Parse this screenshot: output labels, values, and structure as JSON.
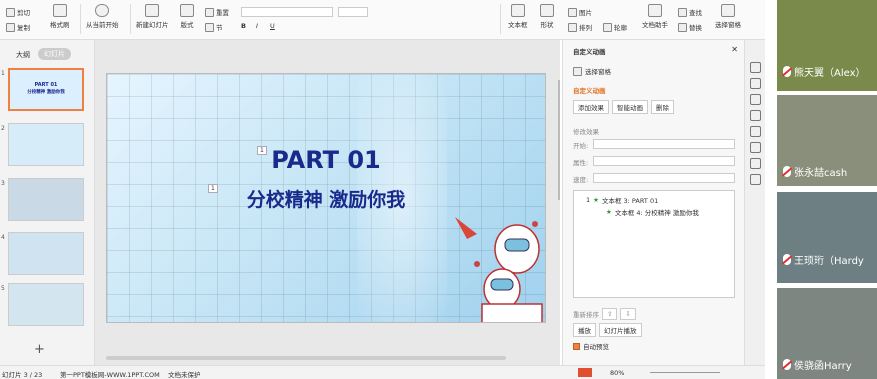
{
  "ribbon": {
    "cut": "剪切",
    "copy": "复制",
    "format_painter": "格式刷",
    "play_from_start": "从当前开始",
    "new_slide": "新建幻灯片",
    "layout": "版式",
    "reset": "重置",
    "section": "节",
    "textbox": "文本框",
    "shapes": "形状",
    "picture": "图片",
    "arrange": "排列",
    "outline": "轮廓",
    "art_text": "文档助手",
    "find": "查找",
    "replace": "替换",
    "select_pane": "选择窗格"
  },
  "left_panel": {
    "tab_outline": "大纲",
    "tab_slides": "幻灯片",
    "add_slide": "+",
    "slide_numbers": [
      "1",
      "2",
      "3",
      "4",
      "5"
    ]
  },
  "slide": {
    "title": "PART  01",
    "subtitle": "分校精神  激励你我",
    "marker1": "1",
    "marker2": "1"
  },
  "animation_pane": {
    "header": "自定义动画",
    "select_pane": "选择窗格",
    "section": "自定义动画",
    "add_effect": "添加效果",
    "smart_animation": "智能动画",
    "delete": "删除",
    "modify_label": "修改效果",
    "start_label": "开始:",
    "property_label": "属性:",
    "speed_label": "速度:",
    "item1": "文本框 3: PART 01",
    "item2": "文本框 4: 分校精神  激励你我",
    "item_index": "1",
    "reorder": "重新排序",
    "play": "播放",
    "slideshow": "幻灯片播放",
    "auto_preview": "自动预览"
  },
  "status": {
    "slide_info": "幻灯片 3 / 23",
    "theme": "第一PPT模板网-WWW.1PPT.COM",
    "doc_protect": "文档未保护",
    "zoom": "80%"
  },
  "participants": [
    {
      "name": "熊天翼（Alex）"
    },
    {
      "name": "张永喆cash"
    },
    {
      "name": "王顼珩（Hardy"
    },
    {
      "name": "侯骁函Harry"
    }
  ]
}
